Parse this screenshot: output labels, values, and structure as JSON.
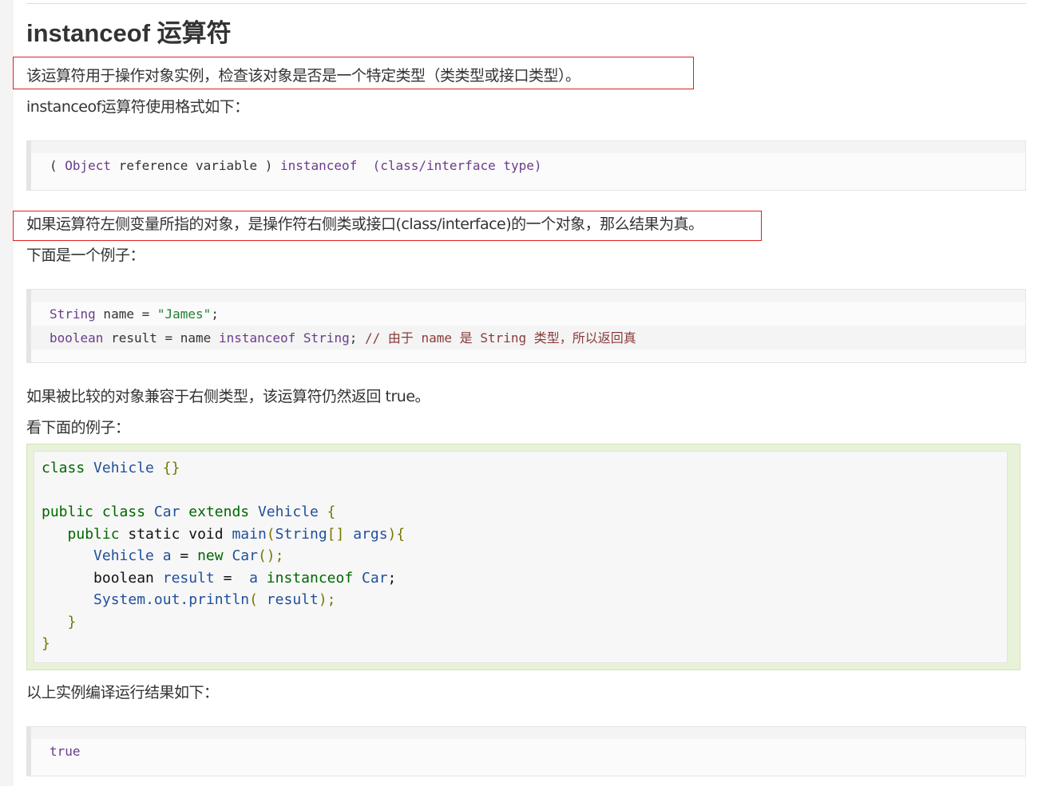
{
  "heading": "instanceof 运算符",
  "intro": "该运算符用于操作对象实例，检查该对象是否是一个特定类型（类类型或接口类型）。",
  "format_label": "instanceof运算符使用格式如下：",
  "syntax_code": [
    "( ",
    "Object",
    " reference variable ",
    ")",
    " instanceof ",
    " (class/interface type)"
  ],
  "rule_text": "如果运算符左侧变量所指的对象，是操作符右侧类或接口(class/interface)的一个对象，那么结果为真。",
  "example_label": "下面是一个例子：",
  "example1": {
    "line1": [
      "String",
      " name ",
      "=",
      " ",
      "\"James\"",
      ";"
    ],
    "line2": [
      "boolean",
      " result ",
      "=",
      " name ",
      "instanceof",
      " ",
      "String",
      ";",
      " ",
      "// 由于 name 是 String 类型，所以返回真"
    ]
  },
  "compat_text": "如果被比较的对象兼容于右侧类型，该运算符仍然返回 true。",
  "see_label": "看下面的例子：",
  "example2": {
    "l1": [
      "class",
      " ",
      "Vehicle",
      " ",
      "{}"
    ],
    "l2": [
      "public",
      " ",
      "class",
      " ",
      "Car",
      " ",
      "extends",
      " ",
      "Vehicle",
      " ",
      "{"
    ],
    "l3": [
      "   ",
      "public",
      " static void ",
      "main",
      "(",
      "String",
      "[]",
      " args",
      "){"
    ],
    "l4": [
      "      ",
      "Vehicle",
      " a ",
      "=",
      " ",
      "new",
      " ",
      "Car",
      "();"
    ],
    "l5": [
      "      ",
      "boolean",
      " result ",
      "=",
      "  a ",
      "instanceof",
      " ",
      "Car",
      ";"
    ],
    "l6": [
      "      ",
      "System",
      ".",
      "out",
      ".",
      "println",
      "(",
      " result",
      ");"
    ],
    "l7": [
      "   ",
      "}"
    ],
    "l8": [
      "",
      "}"
    ]
  },
  "result_label": "以上实例编译运行结果如下：",
  "output": "true"
}
